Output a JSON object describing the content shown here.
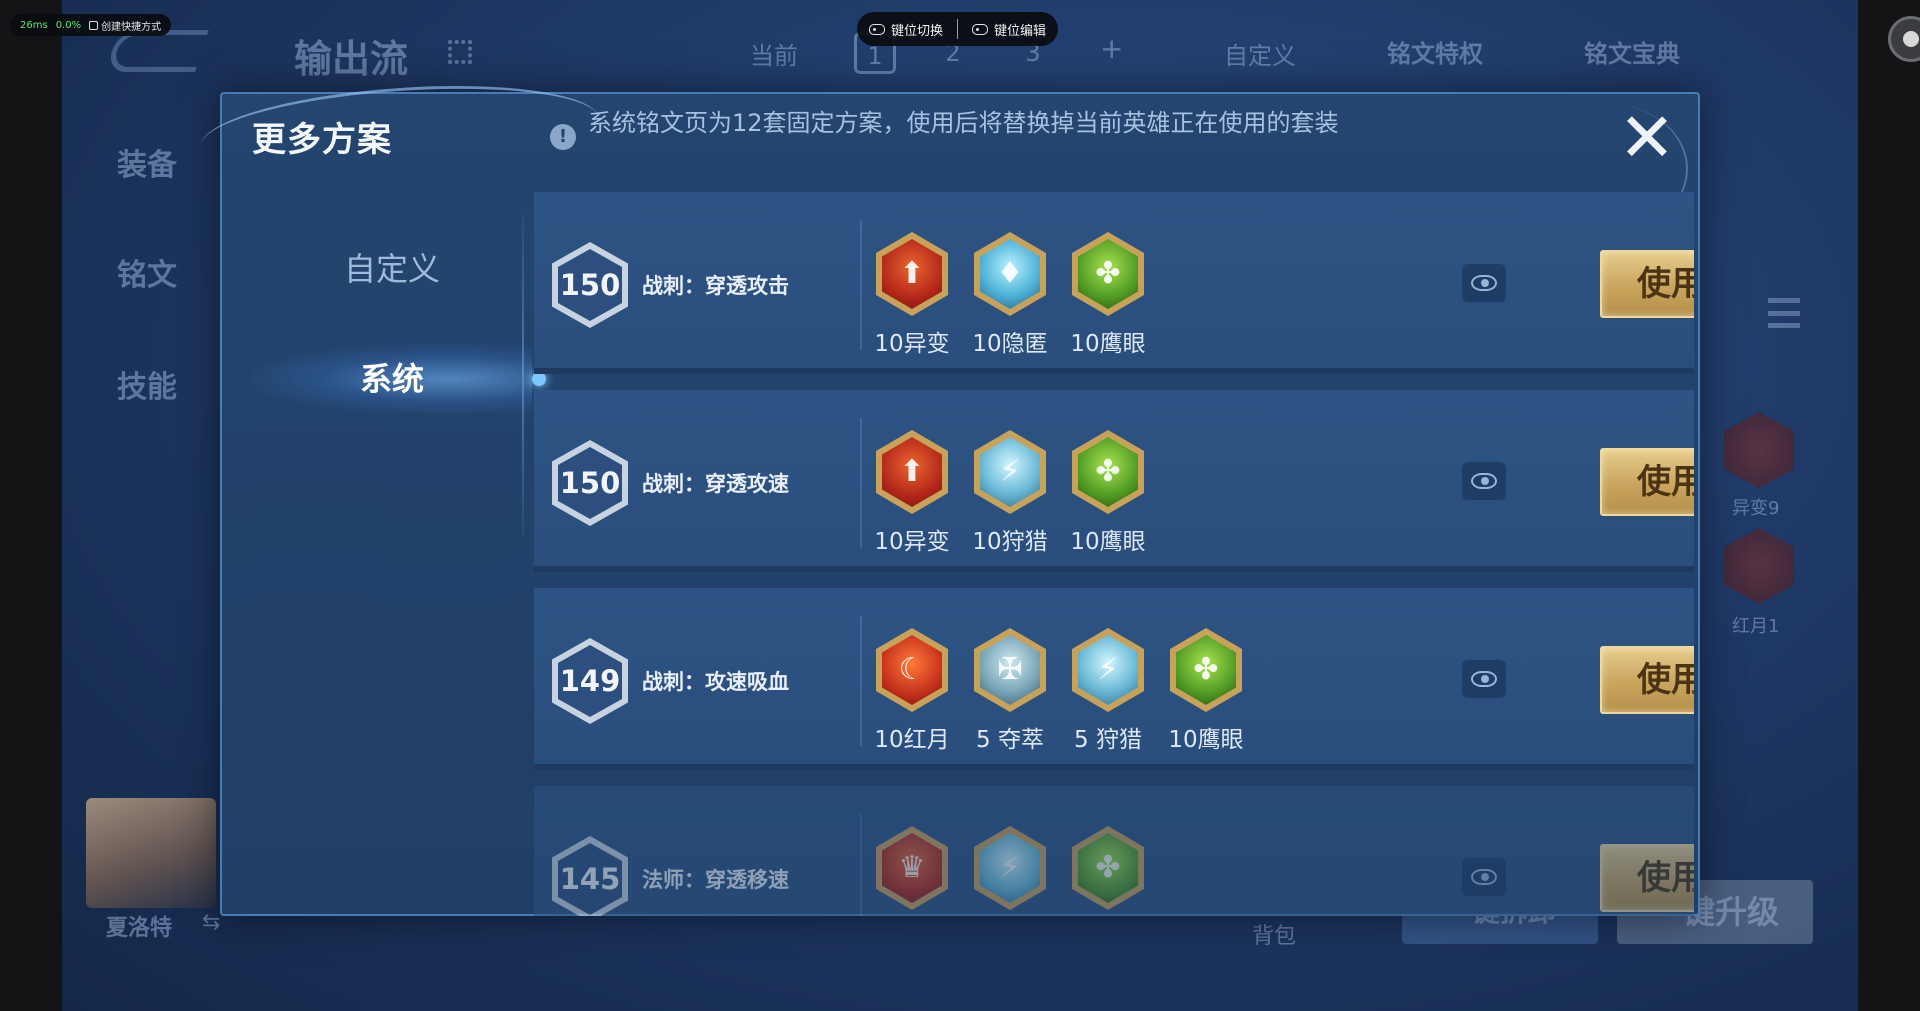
{
  "overlay": {
    "latency": "26ms",
    "loss": "0.0%",
    "shortcut_label": "创建快捷方式",
    "key_switch": "键位切换",
    "key_edit": "键位编辑"
  },
  "background": {
    "title": "输出流",
    "current_label": "当前",
    "tabs": [
      "1",
      "2",
      "3"
    ],
    "plus": "+",
    "custom": "自定义",
    "privilege": "铭文特权",
    "book": "铭文宝典",
    "left_menu": [
      "装备",
      "铭文",
      "技能"
    ],
    "hero_name": "夏洛特",
    "swap": "⇆",
    "bag": "背包",
    "btn_left": "一键拆卸",
    "btn_right": "一键升级",
    "rune_labels": [
      "异变9",
      "红月1"
    ]
  },
  "modal": {
    "title": "更多方案",
    "notice": "系统铭文页为12套固定方案，使用后将替换掉当前英雄正在使用的套装",
    "close": "✕",
    "tabs": [
      {
        "label": "自定义"
      },
      {
        "label": "系统"
      }
    ],
    "use_label": "使用",
    "plans": [
      {
        "level": "150",
        "name": "战刺：穿透攻击",
        "runes": [
          {
            "label": "10异变",
            "icon": "mutation-rune-icon"
          },
          {
            "label": "10隐匿",
            "icon": "stealth-rune-icon"
          },
          {
            "label": "10鹰眼",
            "icon": "hawkeye-rune-icon"
          }
        ]
      },
      {
        "level": "150",
        "name": "战刺：穿透攻速",
        "runes": [
          {
            "label": "10异变",
            "icon": "mutation-rune-icon"
          },
          {
            "label": "10狩猎",
            "icon": "hunting-rune-icon"
          },
          {
            "label": "10鹰眼",
            "icon": "hawkeye-rune-icon"
          }
        ]
      },
      {
        "level": "149",
        "name": "战刺：攻速吸血",
        "runes": [
          {
            "label": "10红月",
            "icon": "red-moon-rune-icon"
          },
          {
            "label": "5 夺萃",
            "icon": "seize-rune-icon"
          },
          {
            "label": "5 狩猎",
            "icon": "hunting-rune-icon"
          },
          {
            "label": "10鹰眼",
            "icon": "hawkeye-rune-icon"
          }
        ]
      },
      {
        "level": "145",
        "name": "法师：穿透移速",
        "runes": [
          {
            "label": "",
            "icon": "red-rune-icon"
          },
          {
            "label": "",
            "icon": "hunting-rune-icon"
          },
          {
            "label": "",
            "icon": "green-rune-icon"
          }
        ]
      }
    ]
  }
}
